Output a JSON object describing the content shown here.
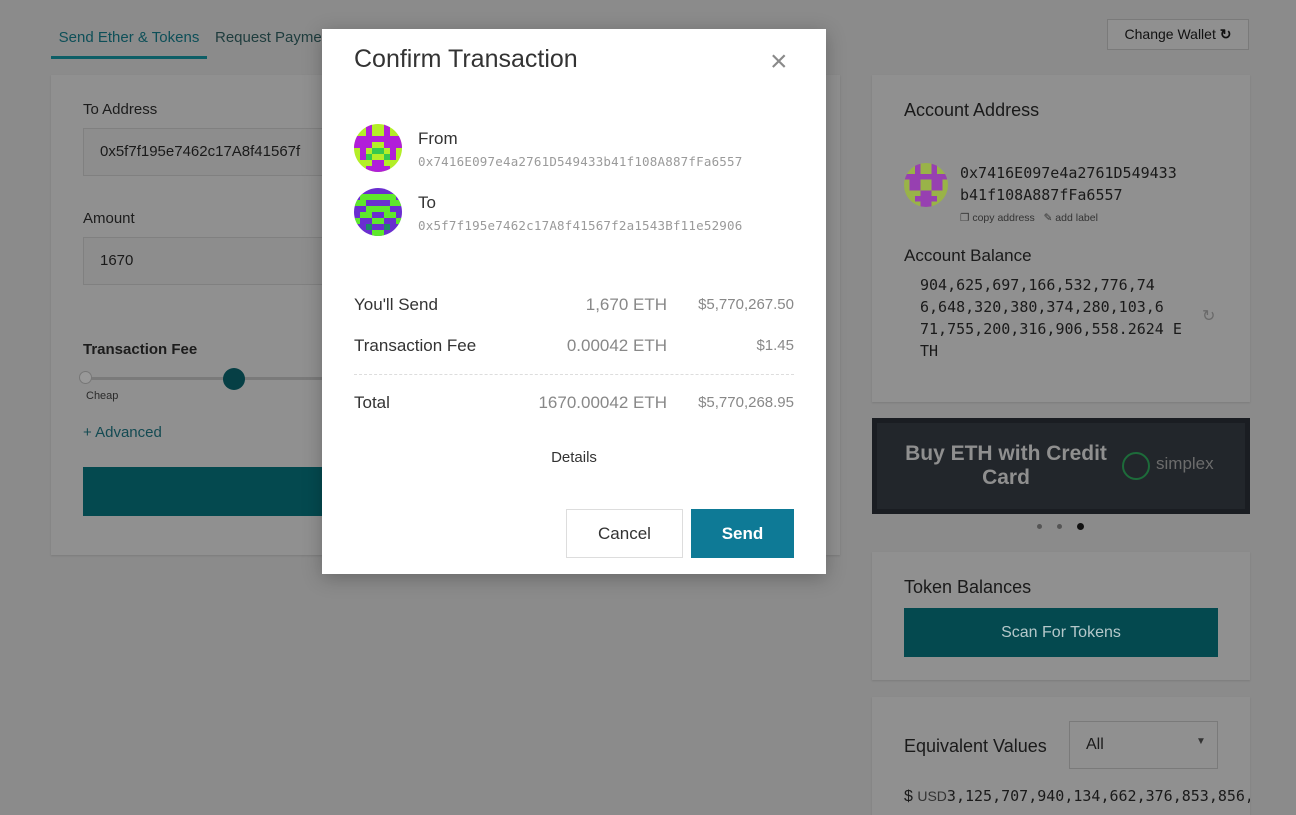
{
  "tabs": [
    "Send Ether & Tokens",
    "Request Payment"
  ],
  "change_wallet": "Change Wallet",
  "send_form": {
    "to_label": "To Address",
    "to_value": "0x5f7f195e7462c17A8f41567f",
    "amount_label": "Amount",
    "amount_value": "1670",
    "fee_label": "Transaction Fee",
    "fee_cheap": "Cheap",
    "advanced": "+ Advanced"
  },
  "account": {
    "address_title": "Account Address",
    "address_line1": "0x7416E097e4a2761D549433",
    "address_line2": "b41f108A887fFa6557",
    "copy_address": "copy address",
    "add_label": "add label",
    "balance_title": "Account Balance",
    "balance_lines": [
      "904,625,697,166,532,776,74",
      "6,648,320,380,374,280,103,6",
      "71,755,200,316,906,558.2624 E",
      "TH"
    ]
  },
  "promo": {
    "text_line1": "Buy ETH with Credit",
    "text_line2": "Card",
    "brand": "simplex"
  },
  "tokens": {
    "title": "Token Balances",
    "scan_button": "Scan For Tokens"
  },
  "equiv": {
    "title": "Equivalent Values",
    "select_value": "All",
    "currency_symbol": "$",
    "currency": "USD",
    "value": "3,125,707,940,134,662,376,853,856,"
  },
  "modal": {
    "title": "Confirm Transaction",
    "from_label": "From",
    "from_address": "0x7416E097e4a2761D549433b41f108A887fFa6557",
    "to_label": "To",
    "to_address": "0x5f7f195e7462c17A8f41567f2a1543Bf11e52906",
    "send_label": "You'll Send",
    "send_eth": "1,670 ETH",
    "send_usd": "$5,770,267.50",
    "fee_label": "Transaction Fee",
    "fee_eth": "0.00042 ETH",
    "fee_usd": "$1.45",
    "total_label": "Total",
    "total_eth": "1670.00042 ETH",
    "total_usd": "$5,770,268.95",
    "details": "Details",
    "cancel": "Cancel",
    "send": "Send"
  }
}
